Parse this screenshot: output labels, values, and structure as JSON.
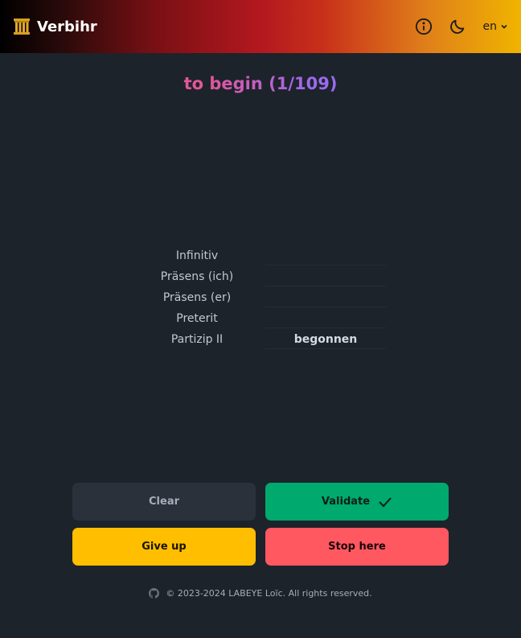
{
  "header": {
    "app_name": "Verbihr",
    "info_icon": "info-circle-icon",
    "theme_icon": "moon-icon",
    "language": "en",
    "logo_icon": "pillar-temple-icon"
  },
  "main": {
    "title": "to begin (1/109)",
    "fields": [
      {
        "label": "Infinitiv",
        "value": ""
      },
      {
        "label": "Präsens (ich)",
        "value": ""
      },
      {
        "label": "Präsens (er)",
        "value": ""
      },
      {
        "label": "Preterit",
        "value": ""
      },
      {
        "label": "Partizip II",
        "value": "begonnen"
      }
    ]
  },
  "buttons": {
    "clear": "Clear",
    "validate": "Validate",
    "give_up": "Give up",
    "stop": "Stop here"
  },
  "footer": {
    "text": "© 2023-2024 LABEYE Loïc. All rights reserved.",
    "github_icon": "github-icon"
  },
  "colors": {
    "background": "#1d232a",
    "validate": "#00a96e",
    "give_up": "#ffbe00",
    "stop": "#ff5861",
    "clear": "#2a313b"
  }
}
